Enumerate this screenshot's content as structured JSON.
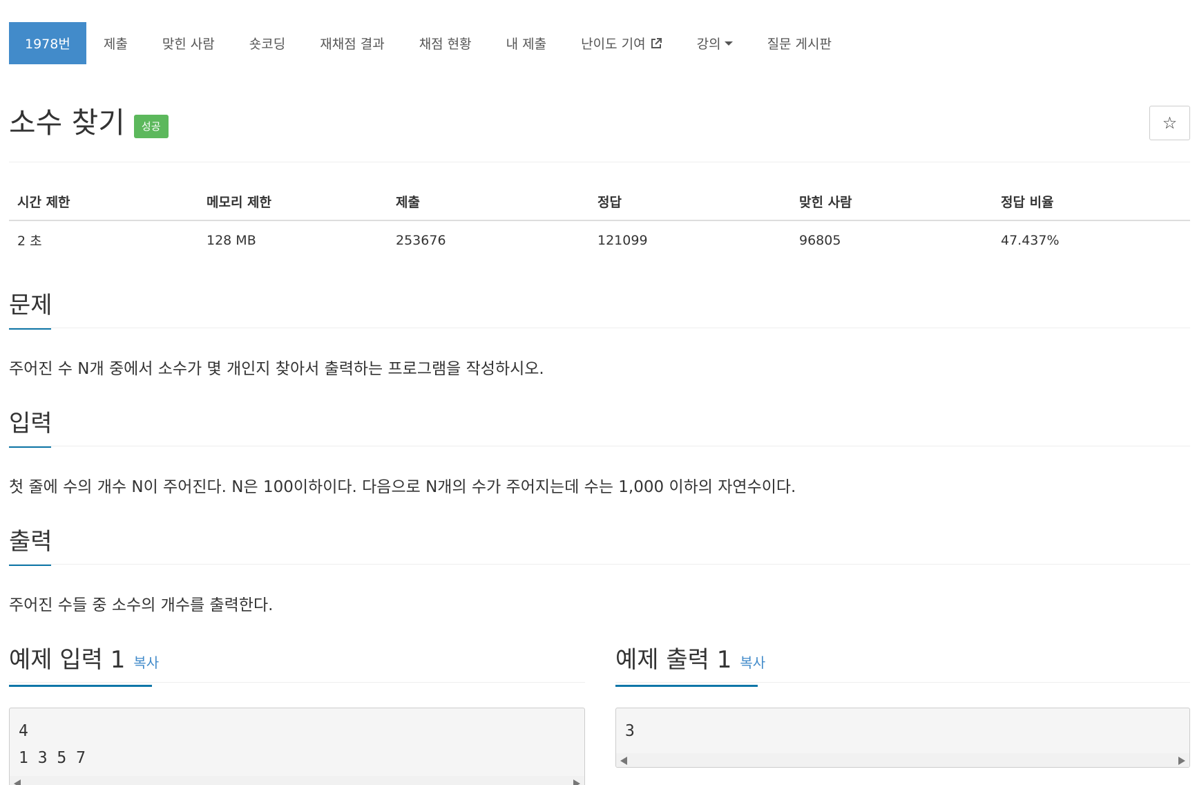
{
  "nav": {
    "items": [
      "1978번",
      "제출",
      "맞힌 사람",
      "숏코딩",
      "재채점 결과",
      "채점 현황",
      "내 제출",
      "난이도 기여",
      "강의",
      "질문 게시판"
    ]
  },
  "problem": {
    "title": "소수 찾기",
    "status_badge": "성공",
    "star_icon": "☆"
  },
  "info_table": {
    "headers": [
      "시간 제한",
      "메모리 제한",
      "제출",
      "정답",
      "맞힌 사람",
      "정답 비율"
    ],
    "values": [
      "2 초",
      "128 MB",
      "253676",
      "121099",
      "96805",
      "47.437%"
    ]
  },
  "sections": {
    "problem_heading": "문제",
    "problem_text": "주어진 수 N개 중에서 소수가 몇 개인지 찾아서 출력하는 프로그램을 작성하시오.",
    "input_heading": "입력",
    "input_text": "첫 줄에 수의 개수 N이 주어진다. N은 100이하이다. 다음으로 N개의 수가 주어지는데 수는 1,000 이하의 자연수이다.",
    "output_heading": "출력",
    "output_text": "주어진 수들 중 소수의 개수를 출력한다."
  },
  "samples": {
    "input_heading": "예제 입력 1",
    "output_heading": "예제 출력 1",
    "copy_label": "복사",
    "input_content": "4\n1 3 5 7",
    "output_content": "3"
  },
  "colors": {
    "accent": "#428bca",
    "badge_success": "#5cb85c",
    "heading_underline": "#0e76a8"
  }
}
